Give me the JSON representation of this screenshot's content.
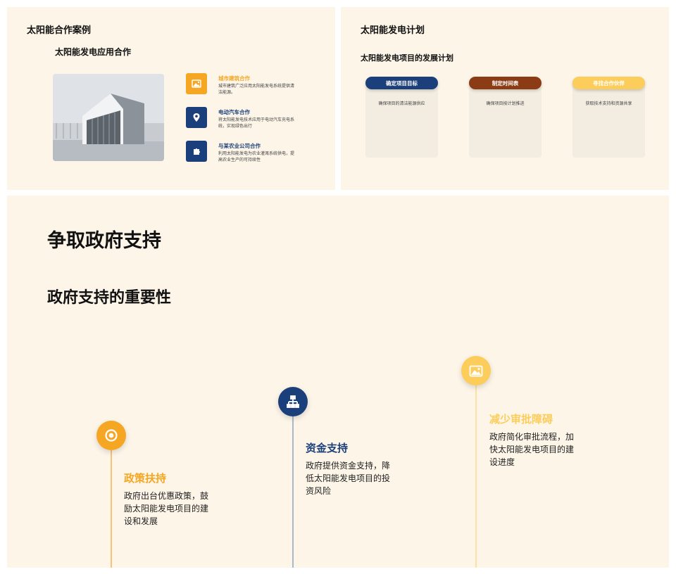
{
  "colors": {
    "background": "#fdf5e8",
    "orange": "#f5a623",
    "yellow": "#fccd5a",
    "navy": "#1b3f7a",
    "brown": "#8b3c14"
  },
  "slide1": {
    "title": "太阳能合作案例",
    "subtitle": "太阳能发电应用合作",
    "photo_icon": "building-photo",
    "items": [
      {
        "icon": "image-icon",
        "title": "城市建筑合作",
        "desc": "城市建筑广泛应用太阳能发电系统提供清洁能源。"
      },
      {
        "icon": "location-pin-icon",
        "title": "电动汽车合作",
        "desc": "将太阳能发电技术应用于电动汽车充电系统，实现绿色出行"
      },
      {
        "icon": "puzzle-icon",
        "title": "与某农业公司合作",
        "desc": "利用太阳能发电为农业灌溉系统供电，提高农业生产的可持续性"
      }
    ]
  },
  "slide2": {
    "title": "太阳能发电计划",
    "subtitle": "太阳能发电项目的发展计划",
    "cards": [
      {
        "label": "确定项目目标",
        "desc": "确保项目的清洁能源供应"
      },
      {
        "label": "制定时间表",
        "desc": "确保项目按计划推进"
      },
      {
        "label": "寻找合作伙伴",
        "desc": "获取技术支持和资源共享"
      }
    ]
  },
  "slide3": {
    "title": "争取政府支持",
    "subtitle": "政府支持的重要性",
    "items": [
      {
        "icon": "target-icon",
        "title": "政策扶持",
        "desc": "政府出台优惠政策，鼓励太阳能发电项目的建设和发展"
      },
      {
        "icon": "hierarchy-icon",
        "title": "资金支持",
        "desc": "政府提供资金支持，降低太阳能发电项目的投资风险"
      },
      {
        "icon": "image-icon",
        "title": "减少审批障碍",
        "desc": "政府简化审批流程，加快太阳能发电项目的建设进度"
      }
    ]
  }
}
